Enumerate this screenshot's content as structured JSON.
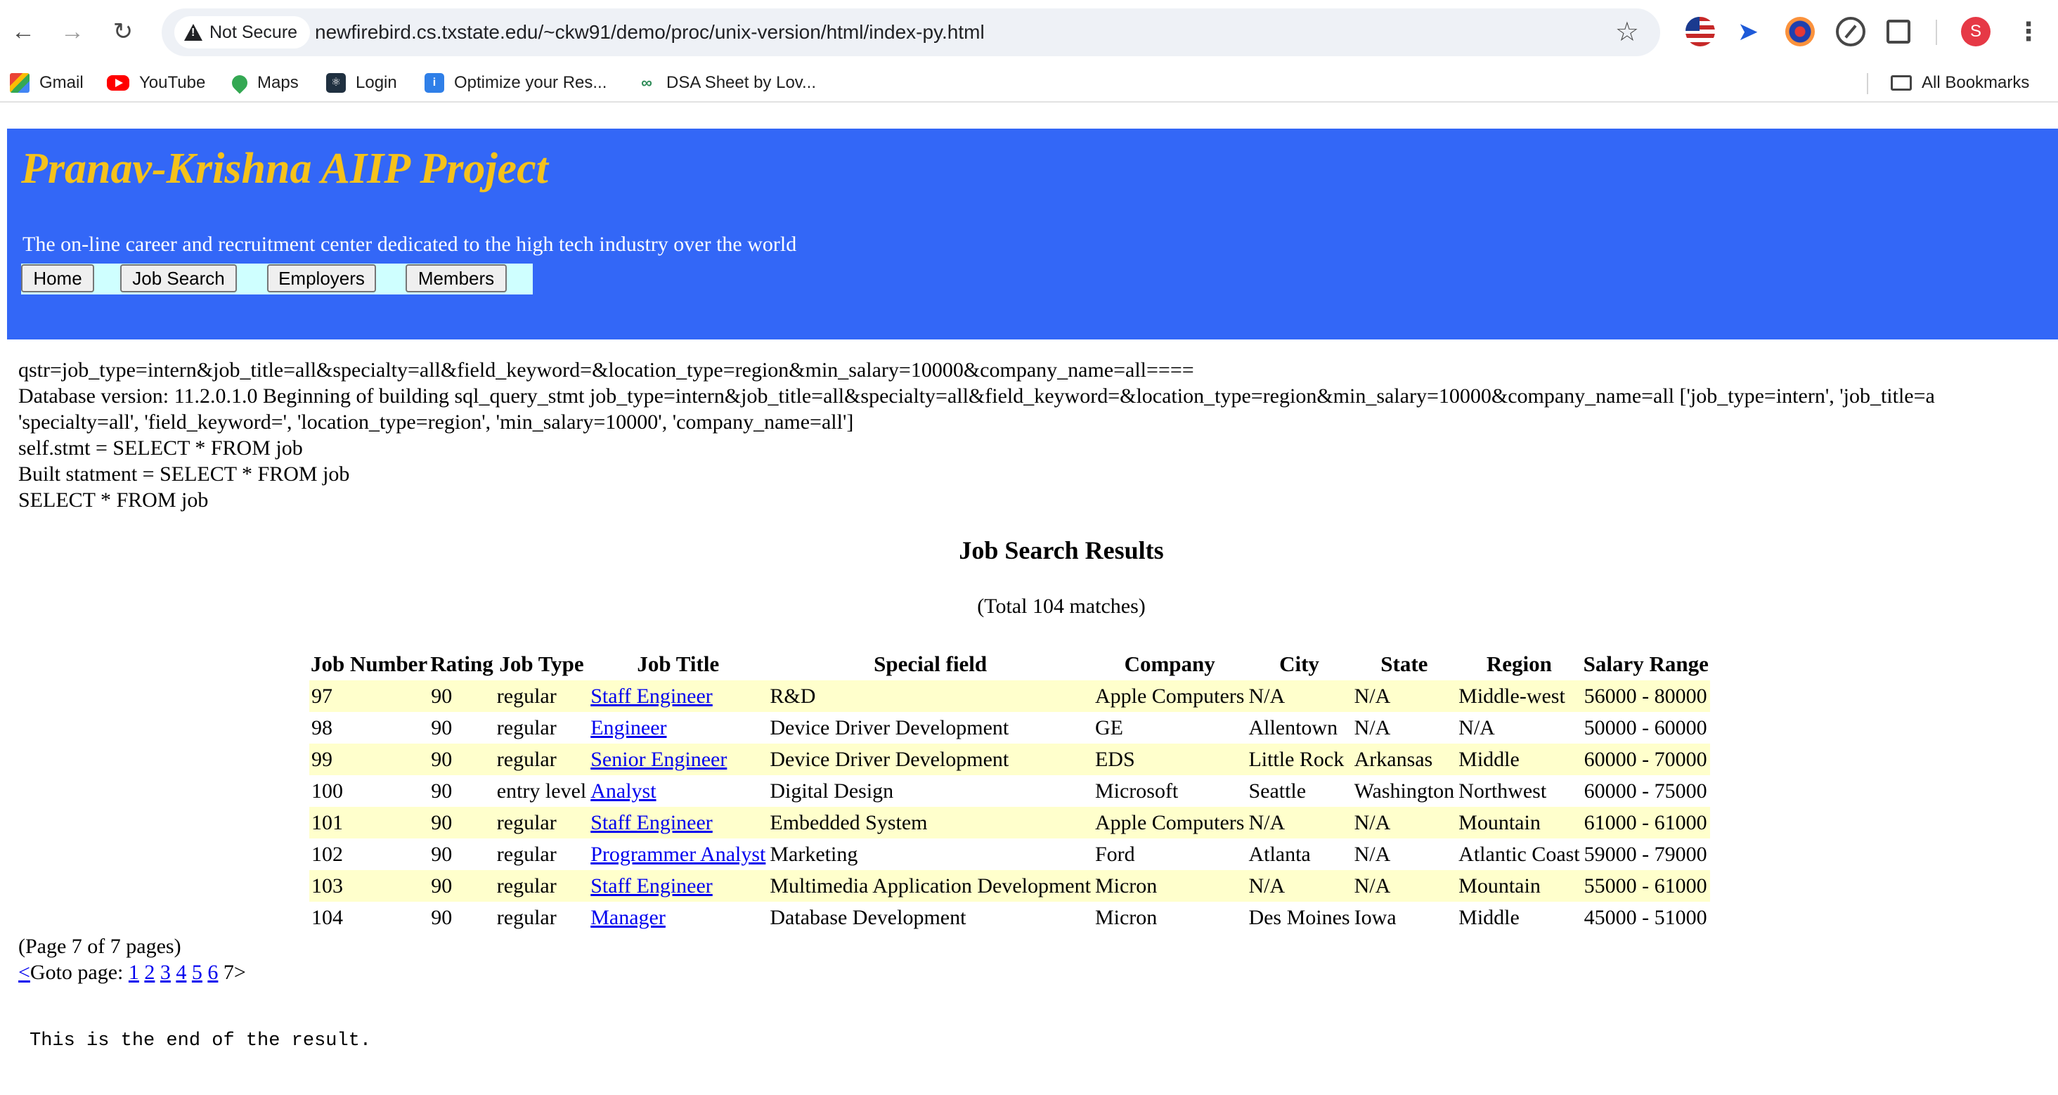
{
  "browser": {
    "security_label": "Not Secure",
    "url": "newfirebird.cs.txstate.edu/~ckw91/demo/proc/unix-version/html/index-py.html",
    "avatar_letter": "S",
    "icons": [
      "back-arrow-icon",
      "forward-arrow-icon",
      "reload-icon",
      "warning-icon",
      "bookmark-star-icon",
      "flag-extension-icon",
      "paper-plane-extension-icon",
      "target-extension-icon",
      "compass-extension-icon",
      "extensions-puzzle-icon",
      "more-options-icon"
    ],
    "bookmarks": [
      {
        "label": "Gmail",
        "icon": "gmail-icon"
      },
      {
        "label": "YouTube",
        "icon": "youtube-icon"
      },
      {
        "label": "Maps",
        "icon": "maps-pin-icon"
      },
      {
        "label": "Login",
        "icon": "react-atom-icon"
      },
      {
        "label": "Optimize your Res...",
        "icon": "document-icon"
      },
      {
        "label": "DSA Sheet by Lov...",
        "icon": "dsa-icon"
      }
    ],
    "all_bookmarks": "All Bookmarks"
  },
  "header": {
    "title": "Pranav-Krishna AIIP Project",
    "subtitle": "The on-line career and recruitment center dedicated to the high tech industry over the world",
    "nav": [
      "Home",
      "Job Search",
      "Employers",
      "Members"
    ],
    "colors": {
      "banner": "#3367f7",
      "title": "#f5c21b",
      "menu_bg": "#cfffff"
    }
  },
  "debug": [
    "qstr=job_type=intern&job_title=all&specialty=all&field_keyword=&location_type=region&min_salary=10000&company_name=all====",
    "Database version: 11.2.0.1.0 Beginning of building sql_query_stmt job_type=intern&job_title=all&specialty=all&field_keyword=&location_type=region&min_salary=10000&company_name=all ['job_type=intern', 'job_title=a",
    "'specialty=all', 'field_keyword=', 'location_type=region', 'min_salary=10000', 'company_name=all']",
    "self.stmt = SELECT * FROM job",
    "Built statment = SELECT * FROM job",
    "SELECT * FROM job"
  ],
  "results": {
    "title": "Job Search Results",
    "total": "(Total 104 matches)",
    "headers": [
      "Job Number",
      "Rating",
      "Job Type",
      "Job Title",
      "Special field",
      "Company",
      "City",
      "State",
      "Region",
      "Salary Range"
    ],
    "row_highlight": "#ffffcc",
    "rows": [
      [
        "97",
        "90",
        "regular",
        "Staff Engineer",
        "R&D",
        "Apple Computers",
        "N/A",
        "N/A",
        "Middle-west",
        "56000 - 80000"
      ],
      [
        "98",
        "90",
        "regular",
        "Engineer",
        "Device Driver Development",
        "GE",
        "Allentown",
        "N/A",
        "N/A",
        "50000 - 60000"
      ],
      [
        "99",
        "90",
        "regular",
        "Senior Engineer",
        "Device Driver Development",
        "EDS",
        "Little Rock",
        "Arkansas",
        "Middle",
        "60000 - 70000"
      ],
      [
        "100",
        "90",
        "entry level",
        "Analyst",
        "Digital Design",
        "Microsoft",
        "Seattle",
        "Washington",
        "Northwest",
        "60000 - 75000"
      ],
      [
        "101",
        "90",
        "regular",
        "Staff Engineer",
        "Embedded System",
        "Apple Computers",
        "N/A",
        "N/A",
        "Mountain",
        "61000 - 61000"
      ],
      [
        "102",
        "90",
        "regular",
        "Programmer Analyst",
        "Marketing",
        "Ford",
        "Atlanta",
        "N/A",
        "Atlantic Coast",
        "59000 - 79000"
      ],
      [
        "103",
        "90",
        "regular",
        "Staff Engineer",
        "Multimedia Application Development",
        "Micron",
        "N/A",
        "N/A",
        "Mountain",
        "55000 - 61000"
      ],
      [
        "104",
        "90",
        "regular",
        "Manager",
        "Database Development",
        "Micron",
        "Des Moines",
        "Iowa",
        "Middle",
        "45000 - 51000"
      ]
    ]
  },
  "pagination": {
    "page_info": "(Page 7 of 7 pages)",
    "prev": "<",
    "goto_label": "Goto page:",
    "pages": [
      "1",
      "2",
      "3",
      "4",
      "5",
      "6"
    ],
    "current": "7",
    "next": ">"
  },
  "footer_text": "This is the end of the result."
}
